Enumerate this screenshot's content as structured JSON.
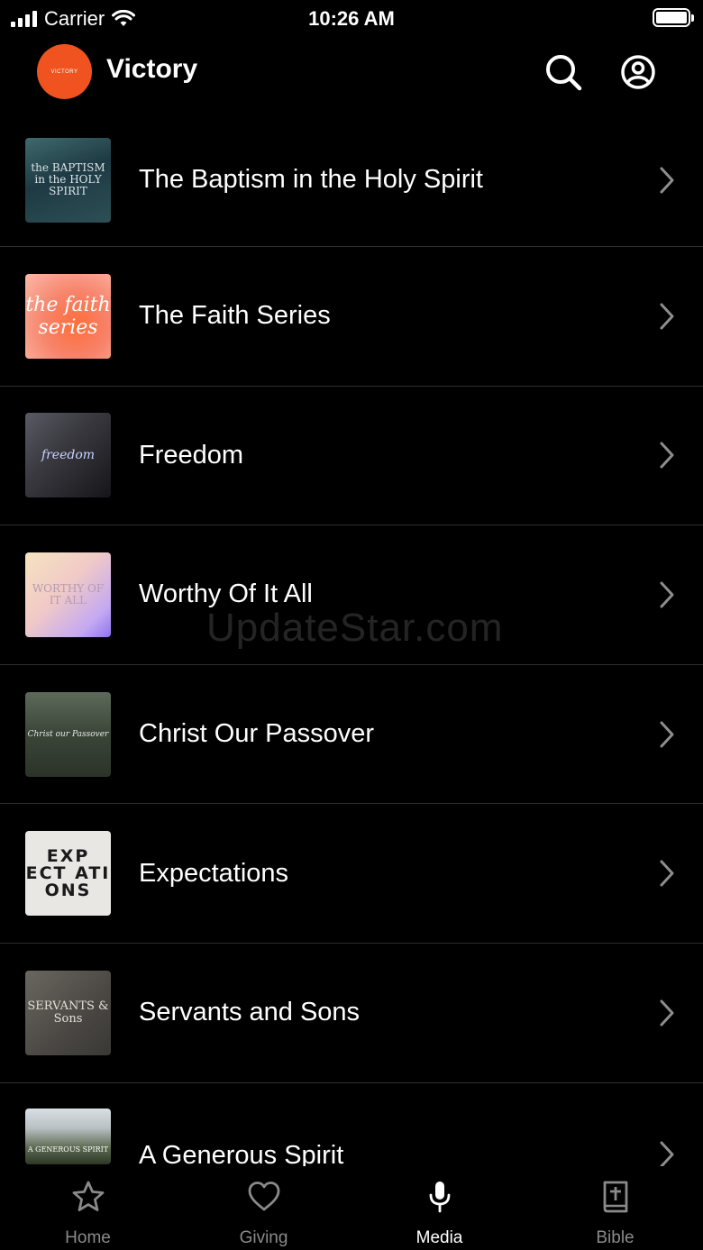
{
  "status_bar": {
    "carrier": "Carrier",
    "time": "10:26 AM"
  },
  "header": {
    "logo_text": "VICTORY",
    "title": "Victory"
  },
  "series": [
    {
      "title": "The Baptism in the Holy Spirit",
      "thumb_text": "the BAPTISM in the HOLY SPIRIT"
    },
    {
      "title": "The Faith Series",
      "thumb_text": "the faith series"
    },
    {
      "title": "Freedom",
      "thumb_text": "freedom"
    },
    {
      "title": "Worthy Of It All",
      "thumb_text": "WORTHY OF IT ALL"
    },
    {
      "title": "Christ Our Passover",
      "thumb_text": "Christ our Passover"
    },
    {
      "title": "Expectations",
      "thumb_text": "EXP ECT ATI ONS"
    },
    {
      "title": "Servants and Sons",
      "thumb_text": "SERVANTS & Sons"
    },
    {
      "title": "A Generous Spirit",
      "thumb_text": "A GENEROUS SPIRIT"
    }
  ],
  "watermark": "UpdateStar.com",
  "tabs": [
    {
      "label": "Home",
      "icon": "star-icon",
      "active": false
    },
    {
      "label": "Giving",
      "icon": "heart-icon",
      "active": false
    },
    {
      "label": "Media",
      "icon": "microphone-icon",
      "active": true
    },
    {
      "label": "Bible",
      "icon": "bible-icon",
      "active": false
    }
  ]
}
